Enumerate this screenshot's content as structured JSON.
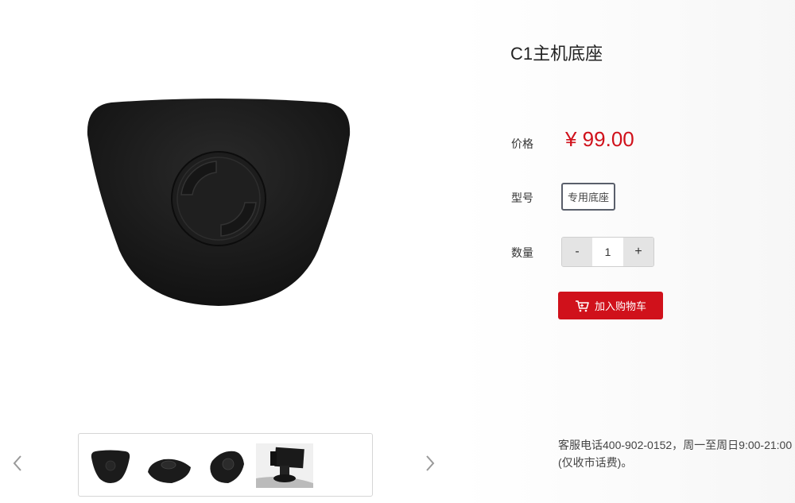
{
  "product": {
    "title": "C1主机底座",
    "price_label": "价格",
    "price": "¥ 99.00",
    "model_label": "型号",
    "model_option": "专用底座",
    "quantity_label": "数量",
    "quantity_minus": "-",
    "quantity_value": "1",
    "quantity_plus": "+",
    "add_to_cart": "加入购物车"
  },
  "service": {
    "line1": "客服电话400-902-0152，周一至周日9:00-21:00",
    "line2": "(仅收市话费)。"
  },
  "gallery": {
    "thumbnails": [
      "base-front",
      "base-angle",
      "base-side",
      "base-mounted"
    ]
  },
  "colors": {
    "accent": "#d0111b",
    "product": "#1b1b1b"
  }
}
